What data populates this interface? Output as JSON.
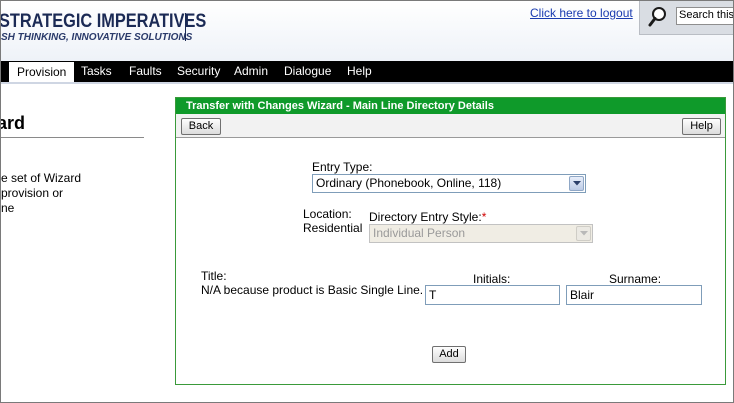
{
  "header": {
    "logo_title": "STRATEGIC IMPERATIVES",
    "logo_subtitle": "SH THINKING, INNOVATIVE SOLUTIONS",
    "logout_link": "Click here to logout",
    "search_value": "Search this p"
  },
  "nav": {
    "items": [
      {
        "label": "Provision",
        "active": true
      },
      {
        "label": "Tasks"
      },
      {
        "label": "Faults"
      },
      {
        "label": "Security"
      },
      {
        "label": "Admin"
      },
      {
        "label": "Dialogue"
      },
      {
        "label": "Help"
      }
    ]
  },
  "left_panel": {
    "title": "ard",
    "lines": [
      "e set of Wizard",
      "provision or",
      "ne"
    ]
  },
  "wizard": {
    "title": "Transfer with Changes Wizard - Main Line Directory Details",
    "back_label": "Back",
    "help_label": "Help",
    "entry_type_label": "Entry Type:",
    "entry_type_value": "Ordinary (Phonebook, Online, 118)",
    "location_label": "Location:",
    "location_value": "Residential",
    "directory_style_label": "Directory Entry Style:",
    "required_marker": "*",
    "directory_style_value": "Individual Person",
    "title_label": "Title:",
    "title_note": "N/A because product is Basic Single Line.",
    "initials_label": "Initials:",
    "initials_value": "T",
    "surname_label": "Surname:",
    "surname_value": "Blair",
    "add_label": "Add"
  },
  "colors": {
    "wizard_header": "#0f9a2a",
    "nav_background": "#000000",
    "link": "#1a3bb0",
    "required": "#d00000"
  }
}
